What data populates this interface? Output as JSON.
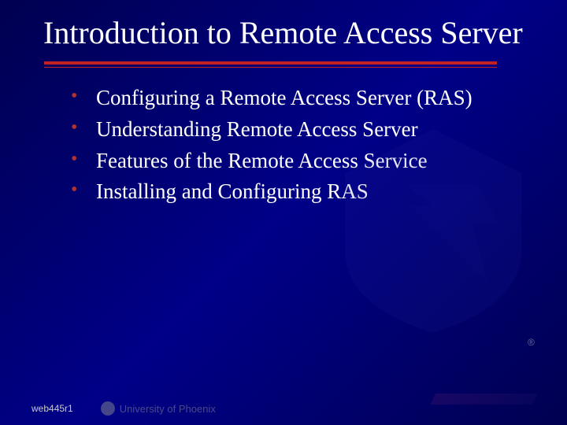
{
  "title": "Introduction to Remote Access Server",
  "bullets": [
    "Configuring a Remote Access Server (RAS)",
    "Understanding Remote Access Server",
    "Features of the Remote Access Service",
    "Installing and Configuring RAS"
  ],
  "footer": {
    "code": "web445r1",
    "org": "University of Phoenix"
  }
}
